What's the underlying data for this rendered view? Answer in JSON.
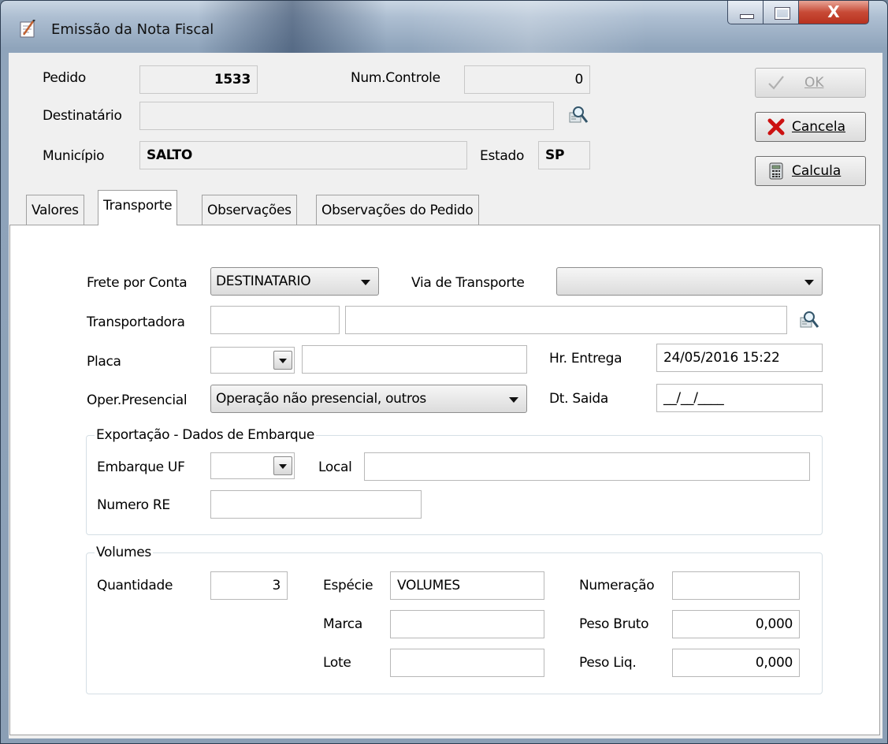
{
  "window": {
    "title": "Emissão da Nota Fiscal",
    "close_glyph": "X"
  },
  "header": {
    "pedido_label": "Pedido",
    "pedido_value": "1533",
    "num_controle_label": "Num.Controle",
    "num_controle_value": "0",
    "destinatario_label": "Destinatário",
    "destinatario_value": "",
    "municipio_label": "Município",
    "municipio_value": "SALTO",
    "estado_label": "Estado",
    "estado_value": "SP"
  },
  "buttons": {
    "ok_label": "OK",
    "cancela_label": "Cancela",
    "calcula_label": "Calcula"
  },
  "tabs": [
    {
      "label": "Valores"
    },
    {
      "label": "Transporte"
    },
    {
      "label": "Observações"
    },
    {
      "label": "Observações do Pedido"
    }
  ],
  "transporte": {
    "frete_label": "Frete por Conta",
    "frete_value": "DESTINATARIO",
    "via_label": "Via de Transporte",
    "via_value": "",
    "transportadora_label": "Transportadora",
    "transportadora_code": "",
    "transportadora_name": "",
    "placa_label": "Placa",
    "placa_uf": "",
    "placa_value": "",
    "hr_entrega_label": "Hr. Entrega",
    "hr_entrega_value": "24/05/2016 15:22",
    "oper_label": "Oper.Presencial",
    "oper_value": "Operação não presencial, outros",
    "dt_saida_label": "Dt. Saida",
    "dt_saida_value": "__/__/____"
  },
  "exportacao": {
    "legend": "Exportação - Dados de Embarque",
    "embarque_uf_label": "Embarque  UF",
    "embarque_uf_value": "",
    "local_label": "Local",
    "local_value": "",
    "numero_re_label": "Numero RE",
    "numero_re_value": ""
  },
  "volumes": {
    "legend": "Volumes",
    "quantidade_label": "Quantidade",
    "quantidade_value": "3",
    "especie_label": "Espécie",
    "especie_value": "VOLUMES",
    "numeracao_label": "Numeração",
    "numeracao_value": "",
    "marca_label": "Marca",
    "marca_value": "",
    "peso_bruto_label": "Peso Bruto",
    "peso_bruto_value": "0,000",
    "lote_label": "Lote",
    "lote_value": "",
    "peso_liq_label": "Peso Liq.",
    "peso_liq_value": "0,000"
  },
  "icons": {
    "app": "notepad-icon",
    "lookup": "magnifier-lookup-icon",
    "ok": "checkmark-icon",
    "cancela": "red-x-icon",
    "calcula": "calculator-icon"
  },
  "colors": {
    "window_frame": "#8fa4bb",
    "client_bg": "#f0f0f0",
    "close_button": "#c74a36",
    "cancel_icon": "#cc1111"
  }
}
